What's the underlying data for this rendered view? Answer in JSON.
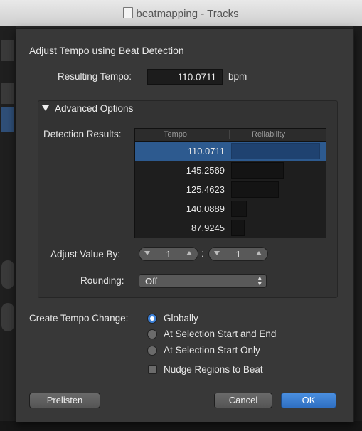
{
  "window": {
    "title": "beatmapping - Tracks"
  },
  "dialog": {
    "title": "Adjust Tempo using Beat Detection",
    "resulting_tempo": {
      "label": "Resulting Tempo:",
      "value": "110.0711",
      "unit": "bpm"
    },
    "advanced": {
      "label": "Advanced Options",
      "detection_results_label": "Detection Results:",
      "columns": [
        "Tempo",
        "Reliability"
      ],
      "rows": [
        {
          "tempo": "110.0711",
          "reliability": 0.98,
          "selected": true
        },
        {
          "tempo": "145.2569",
          "reliability": 0.58,
          "selected": false
        },
        {
          "tempo": "125.4623",
          "reliability": 0.52,
          "selected": false
        },
        {
          "tempo": "140.0889",
          "reliability": 0.17,
          "selected": false
        },
        {
          "tempo": "87.9245",
          "reliability": 0.15,
          "selected": false
        }
      ],
      "adjust_value_by": {
        "label": "Adjust Value By:",
        "value1": "1",
        "separator": ":",
        "value2": "1"
      },
      "rounding": {
        "label": "Rounding:",
        "value": "Off"
      }
    },
    "create_tempo_change": {
      "label": "Create Tempo Change:",
      "options": [
        {
          "label": "Globally",
          "selected": true
        },
        {
          "label": "At Selection Start and End",
          "selected": false
        },
        {
          "label": "At Selection Start Only",
          "selected": false
        }
      ],
      "nudge": {
        "label": "Nudge Regions to Beat",
        "checked": false
      }
    },
    "buttons": {
      "prelisten": "Prelisten",
      "cancel": "Cancel",
      "ok": "OK"
    }
  }
}
